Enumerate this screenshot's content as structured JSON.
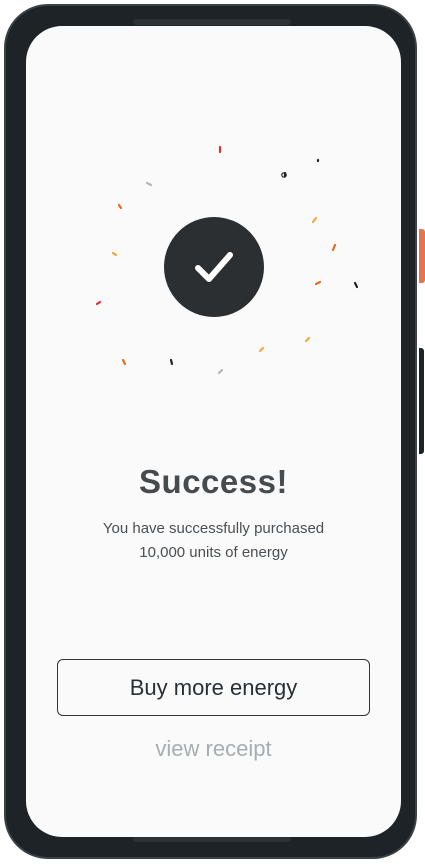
{
  "success_screen": {
    "title": "Success!",
    "message_line1": "You have successfully purchased",
    "message_line2": "10,000 units of energy",
    "buy_button_label": "Buy more energy",
    "receipt_link_label": "view receipt",
    "icon": "checkmark-icon"
  },
  "colors": {
    "title": "#454b4f",
    "message": "#4a4f53",
    "button_text": "#2a2f33",
    "link": "#a8adb0",
    "check_circle": "#2b2f32",
    "phone_accent": "#e8744c",
    "confetti": [
      "#e0322c",
      "#f2a93b",
      "#e86a1f",
      "#222222",
      "#b5b5b5"
    ]
  }
}
